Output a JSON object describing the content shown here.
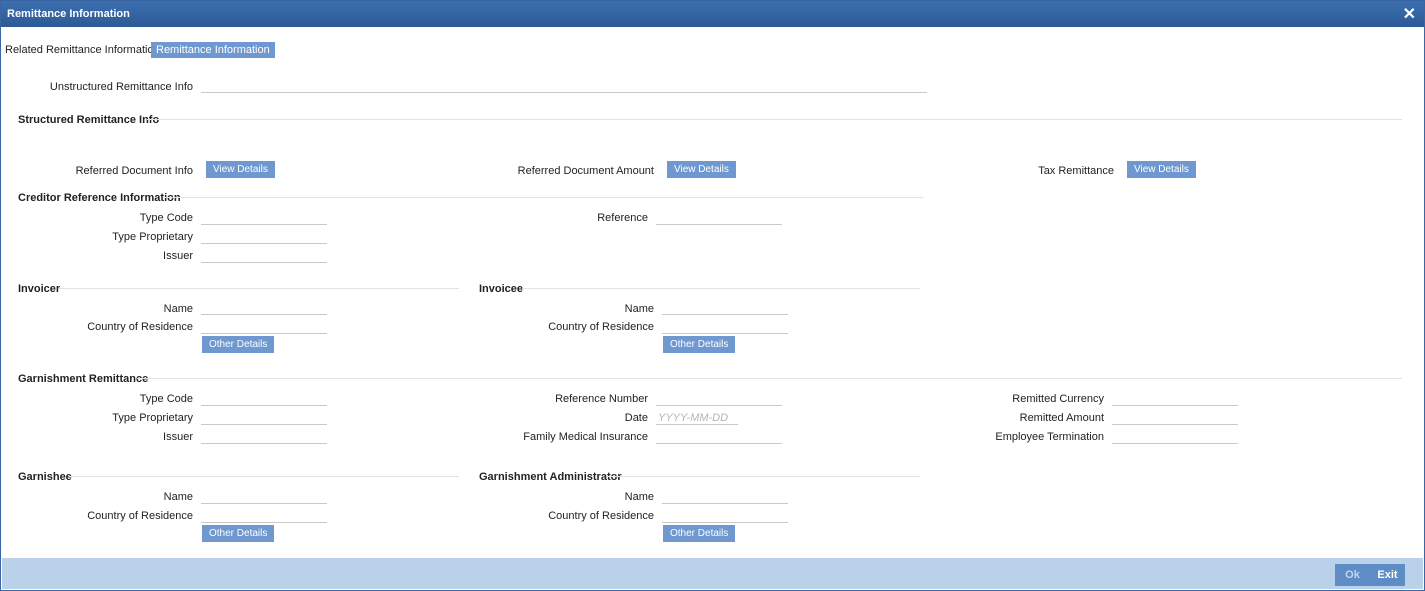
{
  "window": {
    "title": "Remittance Information",
    "close_label": "✕"
  },
  "tabs": [
    {
      "label": "Related Remittance Information"
    },
    {
      "label": "Remittance Information"
    }
  ],
  "unstructured": {
    "label": "Unstructured Remittance Info",
    "value": ""
  },
  "structured": {
    "title": "Structured Remittance Info",
    "referred_document_info": {
      "label": "Referred Document Info",
      "button": "View Details"
    },
    "referred_document_amount": {
      "label": "Referred Document Amount",
      "button": "View Details"
    },
    "tax_remittance": {
      "label": "Tax Remittance",
      "button": "View Details"
    }
  },
  "creditor": {
    "title": "Creditor Reference Information",
    "type_code": {
      "label": "Type Code",
      "value": ""
    },
    "type_proprietary": {
      "label": "Type Proprietary",
      "value": ""
    },
    "issuer": {
      "label": "Issuer",
      "value": ""
    },
    "reference": {
      "label": "Reference",
      "value": ""
    }
  },
  "invoicer": {
    "title": "Invoicer",
    "name": {
      "label": "Name",
      "value": ""
    },
    "country": {
      "label": "Country of Residence",
      "value": ""
    },
    "button": "Other Details"
  },
  "invoicee": {
    "title": "Invoicee",
    "name": {
      "label": "Name",
      "value": ""
    },
    "country": {
      "label": "Country of Residence",
      "value": ""
    },
    "button": "Other Details"
  },
  "garnishment": {
    "title": "Garnishment Remittance",
    "type_code": {
      "label": "Type Code",
      "value": ""
    },
    "type_proprietary": {
      "label": "Type Proprietary",
      "value": ""
    },
    "issuer": {
      "label": "Issuer",
      "value": ""
    },
    "reference_number": {
      "label": "Reference Number",
      "value": ""
    },
    "date": {
      "label": "Date",
      "placeholder": "YYYY-MM-DD"
    },
    "family_medical_insurance": {
      "label": "Family Medical Insurance",
      "value": ""
    },
    "remitted_currency": {
      "label": "Remitted Currency",
      "value": ""
    },
    "remitted_amount": {
      "label": "Remitted Amount",
      "value": ""
    },
    "employee_termination": {
      "label": "Employee Termination",
      "value": ""
    }
  },
  "garnishee": {
    "title": "Garnishee",
    "name": {
      "label": "Name",
      "value": ""
    },
    "country": {
      "label": "Country of Residence",
      "value": ""
    },
    "button": "Other Details"
  },
  "administrator": {
    "title": "Garnishment Administrator",
    "name": {
      "label": "Name",
      "value": ""
    },
    "country": {
      "label": "Country of Residence",
      "value": ""
    },
    "button": "Other Details"
  },
  "footer": {
    "ok_label": "Ok",
    "exit_label": "Exit"
  },
  "colors": {
    "titlebar": "#2f5f9c",
    "button": "#6e98cf",
    "footer": "#b9d2ea"
  }
}
